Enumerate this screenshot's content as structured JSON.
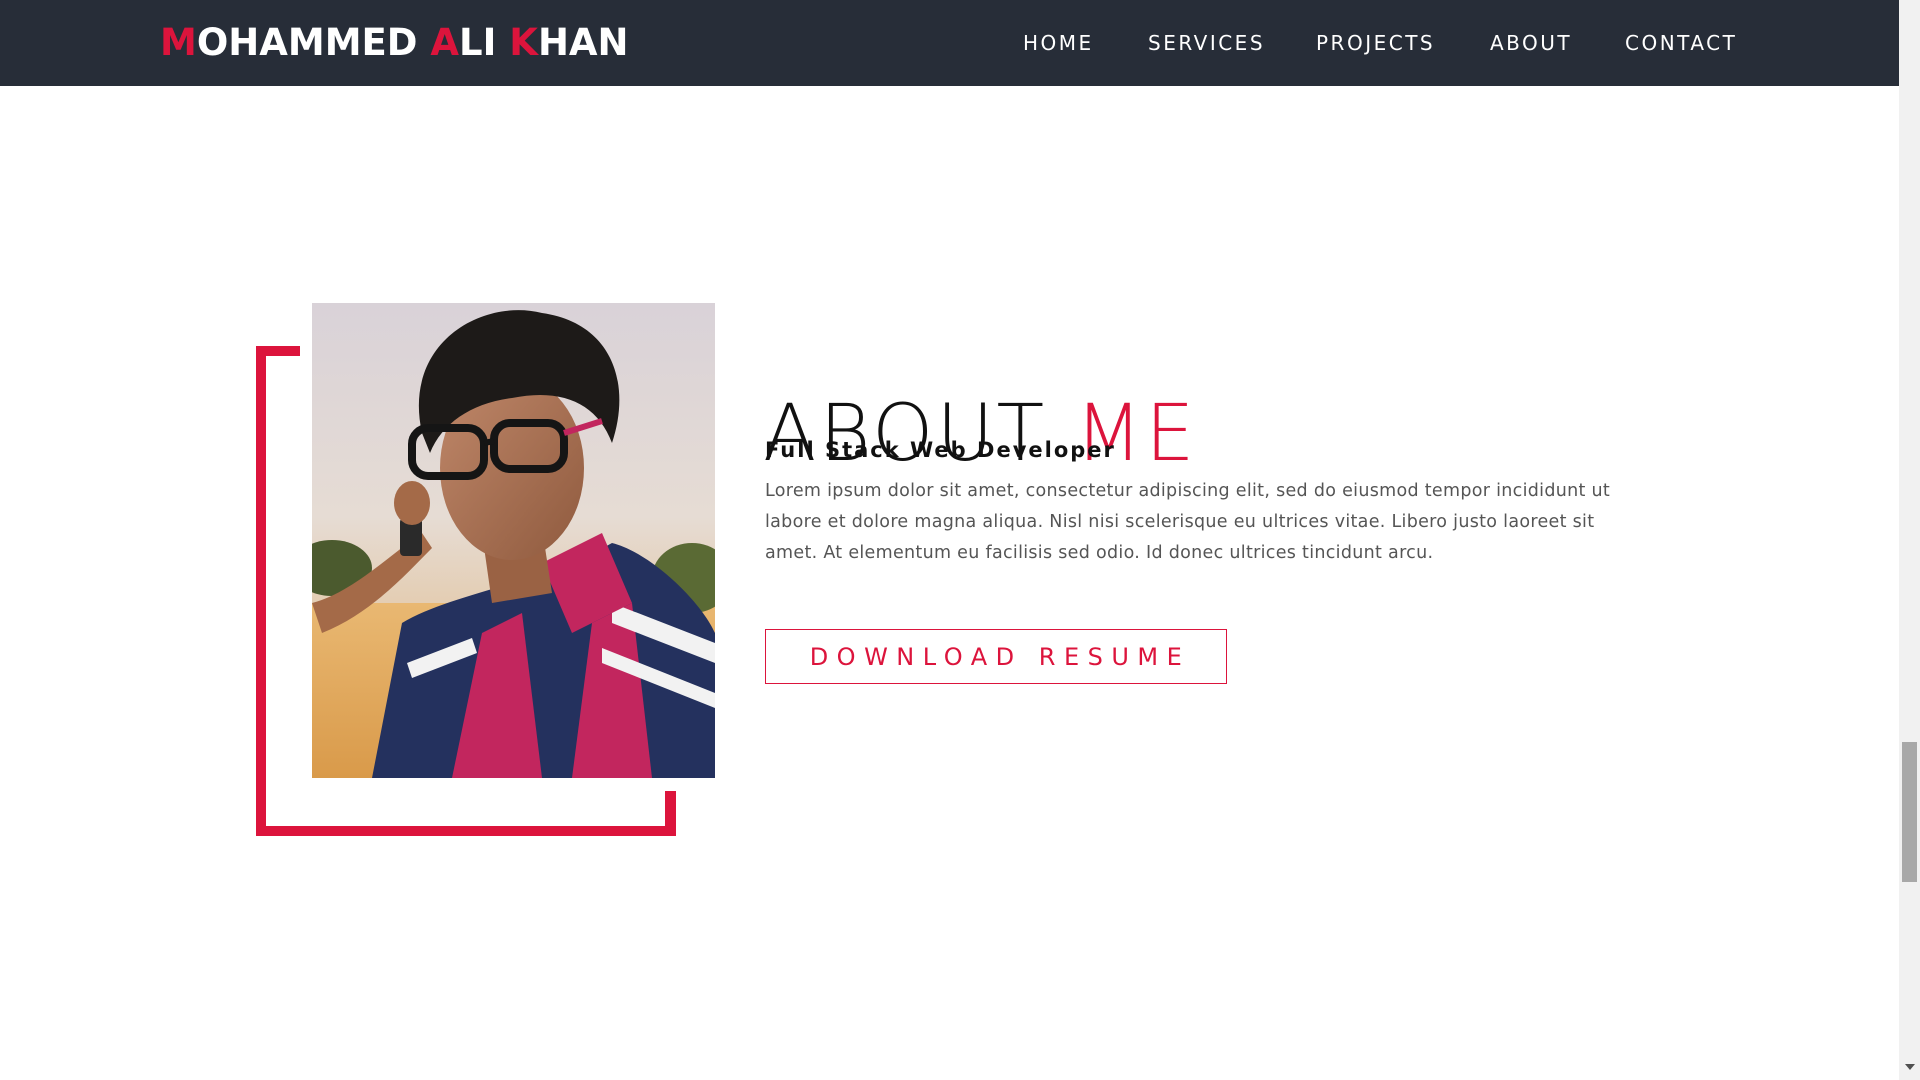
{
  "header": {
    "brand": {
      "parts": [
        {
          "text": "M",
          "accent": true
        },
        {
          "text": "OHAMMED ",
          "accent": false
        },
        {
          "text": "A",
          "accent": true
        },
        {
          "text": "LI ",
          "accent": false
        },
        {
          "text": "K",
          "accent": true
        },
        {
          "text": "HAN",
          "accent": false
        }
      ]
    },
    "nav": {
      "home": "HOME",
      "services": "SERVICES",
      "projects": "PROJECTS",
      "about": "ABOUT",
      "contact": "CONTACT"
    }
  },
  "about": {
    "title_main": "ABOUT ",
    "title_accent": "ME",
    "subtitle": "Full Stack Web Developer",
    "bio": "Lorem ipsum dolor sit amet, consectetur adipiscing elit, sed do eiusmod tempor incididunt ut labore et dolore magna aliqua. Nisl nisi scelerisque eu ultrices vitae. Libero justo laoreet sit amet. At elementum eu facilisis sed odio. Id donec ultrices tincidunt arcu.",
    "resume_button": "DOWNLOAD RESUME"
  },
  "colors": {
    "accent": "#dc143c",
    "header_bg": "#272d38"
  },
  "icons": {
    "scroll_down": "chevron-down-icon"
  }
}
